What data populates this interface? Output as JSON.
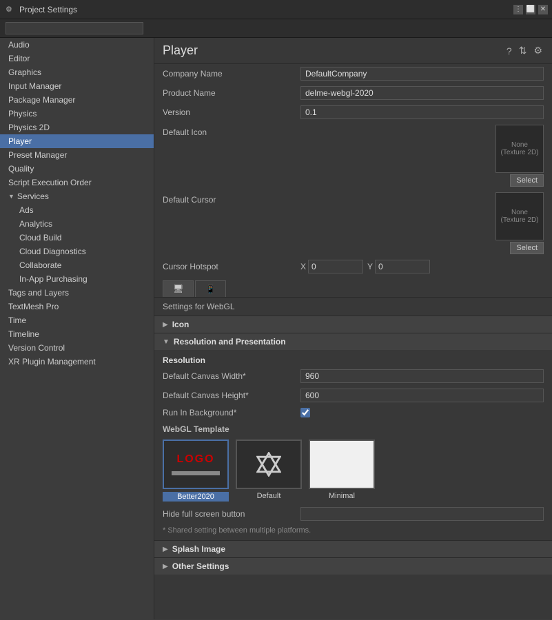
{
  "titleBar": {
    "title": "Project Settings",
    "icon": "⚙"
  },
  "search": {
    "placeholder": ""
  },
  "sidebar": {
    "items": [
      {
        "id": "audio",
        "label": "Audio",
        "indent": 0,
        "active": false
      },
      {
        "id": "editor",
        "label": "Editor",
        "indent": 0,
        "active": false
      },
      {
        "id": "graphics",
        "label": "Graphics",
        "indent": 0,
        "active": false
      },
      {
        "id": "input-manager",
        "label": "Input Manager",
        "indent": 0,
        "active": false
      },
      {
        "id": "package-manager",
        "label": "Package Manager",
        "indent": 0,
        "active": false
      },
      {
        "id": "physics",
        "label": "Physics",
        "indent": 0,
        "active": false
      },
      {
        "id": "physics-2d",
        "label": "Physics 2D",
        "indent": 0,
        "active": false
      },
      {
        "id": "player",
        "label": "Player",
        "indent": 0,
        "active": true
      },
      {
        "id": "preset-manager",
        "label": "Preset Manager",
        "indent": 0,
        "active": false
      },
      {
        "id": "quality",
        "label": "Quality",
        "indent": 0,
        "active": false
      },
      {
        "id": "script-execution-order",
        "label": "Script Execution Order",
        "indent": 0,
        "active": false
      },
      {
        "id": "services",
        "label": "Services",
        "indent": 0,
        "active": false,
        "expanded": true,
        "hasArrow": true
      },
      {
        "id": "ads",
        "label": "Ads",
        "indent": 1,
        "active": false
      },
      {
        "id": "analytics",
        "label": "Analytics",
        "indent": 1,
        "active": false
      },
      {
        "id": "cloud-build",
        "label": "Cloud Build",
        "indent": 1,
        "active": false
      },
      {
        "id": "cloud-diagnostics",
        "label": "Cloud Diagnostics",
        "indent": 1,
        "active": false
      },
      {
        "id": "collaborate",
        "label": "Collaborate",
        "indent": 1,
        "active": false
      },
      {
        "id": "in-app-purchasing",
        "label": "In-App Purchasing",
        "indent": 1,
        "active": false
      },
      {
        "id": "tags-and-layers",
        "label": "Tags and Layers",
        "indent": 0,
        "active": false
      },
      {
        "id": "textmesh-pro",
        "label": "TextMesh Pro",
        "indent": 0,
        "active": false
      },
      {
        "id": "time",
        "label": "Time",
        "indent": 0,
        "active": false
      },
      {
        "id": "timeline",
        "label": "Timeline",
        "indent": 0,
        "active": false
      },
      {
        "id": "version-control",
        "label": "Version Control",
        "indent": 0,
        "active": false
      },
      {
        "id": "xr-plugin-management",
        "label": "XR Plugin Management",
        "indent": 0,
        "active": false
      }
    ]
  },
  "content": {
    "title": "Player",
    "headerIcons": [
      "?",
      "⇅",
      "⚙"
    ],
    "fields": {
      "companyName": {
        "label": "Company Name",
        "value": "DefaultCompany"
      },
      "productName": {
        "label": "Product Name",
        "value": "delme-webgl-2020"
      },
      "version": {
        "label": "Version",
        "value": "0.1"
      },
      "defaultIcon": {
        "label": "Default Icon",
        "noneLabel": "None",
        "textureLabel": "(Texture 2D)",
        "selectLabel": "Select"
      },
      "defaultCursor": {
        "label": "Default Cursor",
        "noneLabel": "None",
        "textureLabel": "(Texture 2D)",
        "selectLabel": "Select"
      },
      "cursorHotspot": {
        "label": "Cursor Hotspot",
        "xLabel": "X",
        "xValue": "0",
        "yLabel": "Y",
        "yValue": "0"
      }
    },
    "platformTabs": [
      {
        "id": "webgl",
        "icon": "🖥",
        "active": true
      },
      {
        "id": "mobile",
        "icon": "📱",
        "active": false
      }
    ],
    "settingsFor": "Settings for WebGL",
    "sections": {
      "icon": {
        "label": "Icon",
        "expanded": false
      },
      "resolutionAndPresentation": {
        "label": "Resolution and Presentation",
        "expanded": true,
        "resolution": {
          "label": "Resolution",
          "fields": [
            {
              "label": "Default Canvas Width*",
              "value": "960"
            },
            {
              "label": "Default Canvas Height*",
              "value": "600"
            },
            {
              "label": "Run In Background*",
              "type": "checkbox",
              "checked": true
            }
          ]
        },
        "webglTemplate": {
          "label": "WebGL Template",
          "options": [
            {
              "id": "better2020",
              "name": "Better2020",
              "selected": true,
              "type": "logo"
            },
            {
              "id": "default",
              "name": "Default",
              "selected": false,
              "type": "unity"
            },
            {
              "id": "minimal",
              "name": "Minimal",
              "selected": false,
              "type": "minimal"
            }
          ]
        },
        "hideFullScreen": {
          "label": "Hide full screen button",
          "value": ""
        },
        "sharedNote": "* Shared setting between multiple platforms."
      },
      "splashImage": {
        "label": "Splash Image",
        "expanded": false
      },
      "otherSettings": {
        "label": "Other Settings",
        "expanded": false
      }
    }
  }
}
